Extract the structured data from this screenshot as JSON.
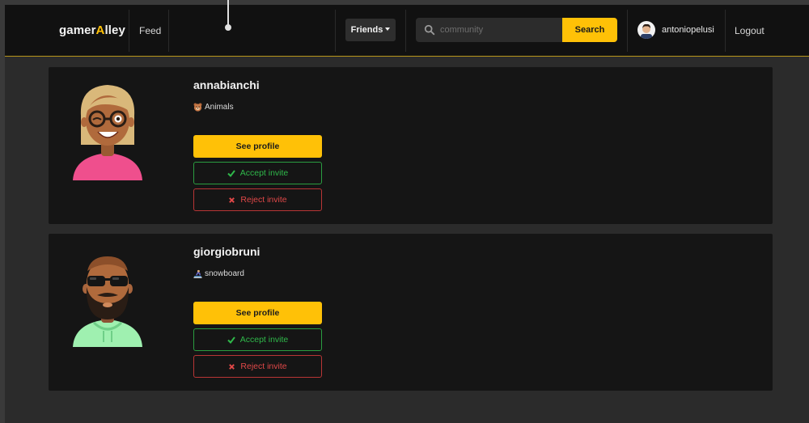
{
  "navbar": {
    "brand_prefix": "gamer",
    "brand_accent": "A",
    "brand_suffix": "lley",
    "feed_label": "Feed",
    "friends_label": "Friends",
    "search_placeholder": "community",
    "search_button": "Search",
    "username": "antoniopelusi",
    "logout_label": "Logout"
  },
  "colors": {
    "accent": "#ffc107",
    "accept": "#2fb84a",
    "reject": "#e04848",
    "card_bg": "#151515",
    "page_bg": "#2b2b2b"
  },
  "invites": [
    {
      "username": "annabianchi",
      "interest": "Animals",
      "interest_icon": "bear-face-emoji",
      "see_profile": "See profile",
      "accept": "Accept invite",
      "reject": "Reject invite"
    },
    {
      "username": "giorgiobruni",
      "interest": "snowboard",
      "interest_icon": "snowboarder-emoji",
      "see_profile": "See profile",
      "accept": "Accept invite",
      "reject": "Reject invite"
    }
  ]
}
